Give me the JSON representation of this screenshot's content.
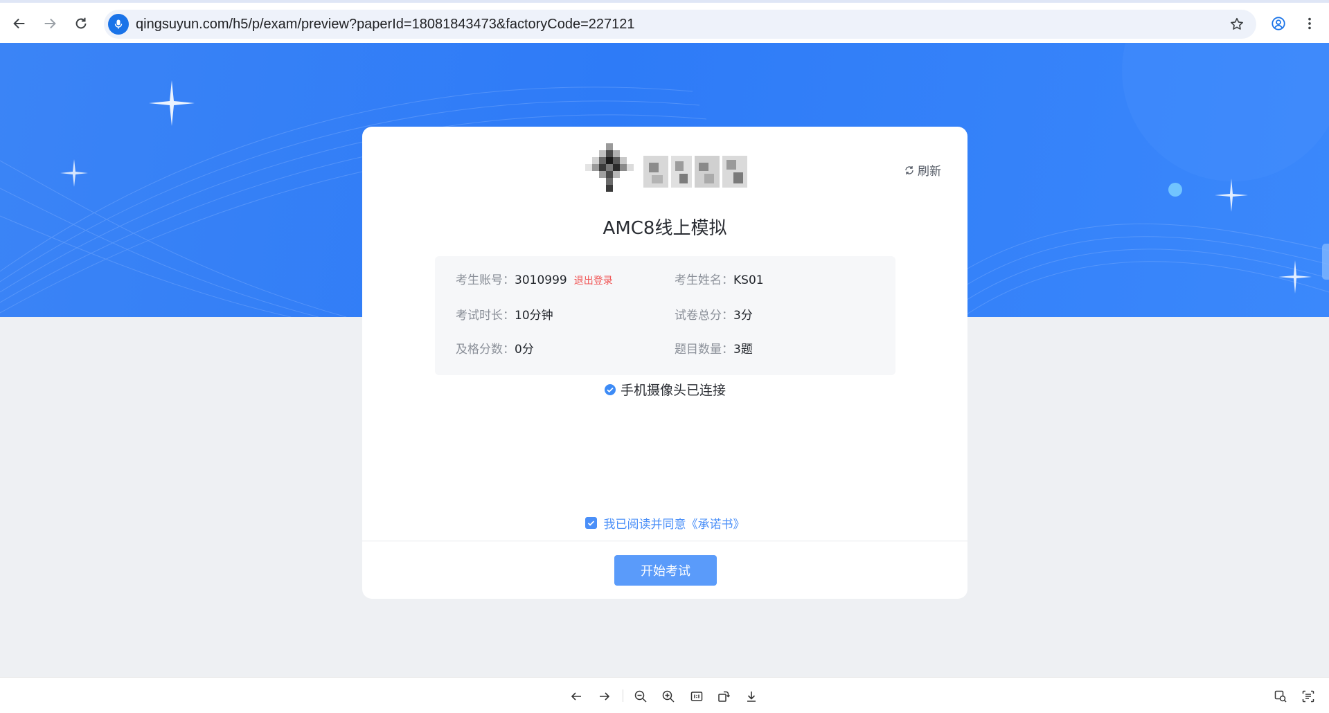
{
  "browser": {
    "url": "qingsuyun.com/h5/p/exam/preview?paperId=18081843473&factoryCode=227121",
    "icons": [
      "back-arrow-icon",
      "forward-arrow-icon",
      "reload-icon",
      "microphone-icon",
      "star-icon",
      "profile-icon",
      "kebab-menu-icon"
    ]
  },
  "card": {
    "refresh_label": "刷新",
    "title": "AMC8线上模拟",
    "info": {
      "account_label": "考生账号：",
      "account_value": "3010999",
      "logout_label": "退出登录",
      "name_label": "考生姓名：",
      "name_value": "KS01",
      "duration_label": "考试时长：",
      "duration_value": "10分钟",
      "total_label": "试卷总分：",
      "total_value": "3分",
      "pass_label": "及格分数：",
      "pass_value": "0分",
      "count_label": "题目数量：",
      "count_value": "3题"
    },
    "camera_status": "手机摄像头已连接",
    "agree_text": "我已阅读并同意《承诺书》",
    "agree_checked": true,
    "start_button": "开始考试"
  },
  "colors": {
    "banner_blue": "#2e7bf7",
    "link_blue": "#4a8ff8",
    "start_button": "#5a9bfa",
    "logout_red": "#f05252",
    "page_bg": "#eef0f3"
  },
  "viewer_toolbar": {
    "icons": [
      "prev-arrow-icon",
      "next-arrow-icon",
      "zoom-out-icon",
      "zoom-in-icon",
      "actual-size-icon",
      "rotate-icon",
      "download-icon",
      "image-search-icon",
      "text-extract-icon"
    ]
  }
}
